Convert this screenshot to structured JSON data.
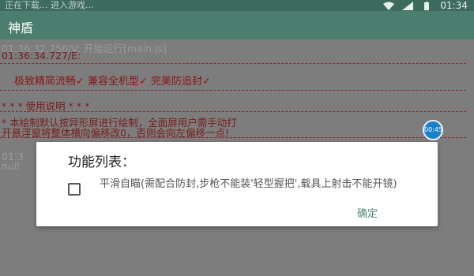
{
  "status_bar": {
    "left_text": "正在下载... 进入游戏...",
    "time": "01:34",
    "icons": [
      "download-icon",
      "wifi-icon",
      "signal-icon",
      "battery-icon"
    ]
  },
  "app_bar": {
    "title": "神盾"
  },
  "log": {
    "line1": "01:36:32.756/V: 开始运行[main.js]",
    "line2": "01:36:34.727/E:",
    "features": "极致精简流畅✓ 兼容全机型✓ 完美防追封✓",
    "usage_title": "* * * 使用说明 * * *",
    "usage_line1": "* 本绘制默认按异形屏进行绘制，全面屏用户需手动打",
    "usage_line2": "开悬浮窗将整体横向偏移改0，否则会向左偏移一点!",
    "faded1": "01:3",
    "faded2": "null"
  },
  "floating_button": {
    "label": "00:45"
  },
  "dialog": {
    "title": "功能列表：",
    "option_label": "平滑自瞄(需配合防封,步枪不能装'轻型握把',载具上射击不能开镜)",
    "option_checked": false,
    "ok_label": "确定"
  },
  "colors": {
    "status_bar": "#3d6b5e",
    "app_bar": "#4c7e6f",
    "overlay": "#7d7d7d",
    "log_red": "#7a1b1b",
    "accent_text": "#4c8a78"
  }
}
